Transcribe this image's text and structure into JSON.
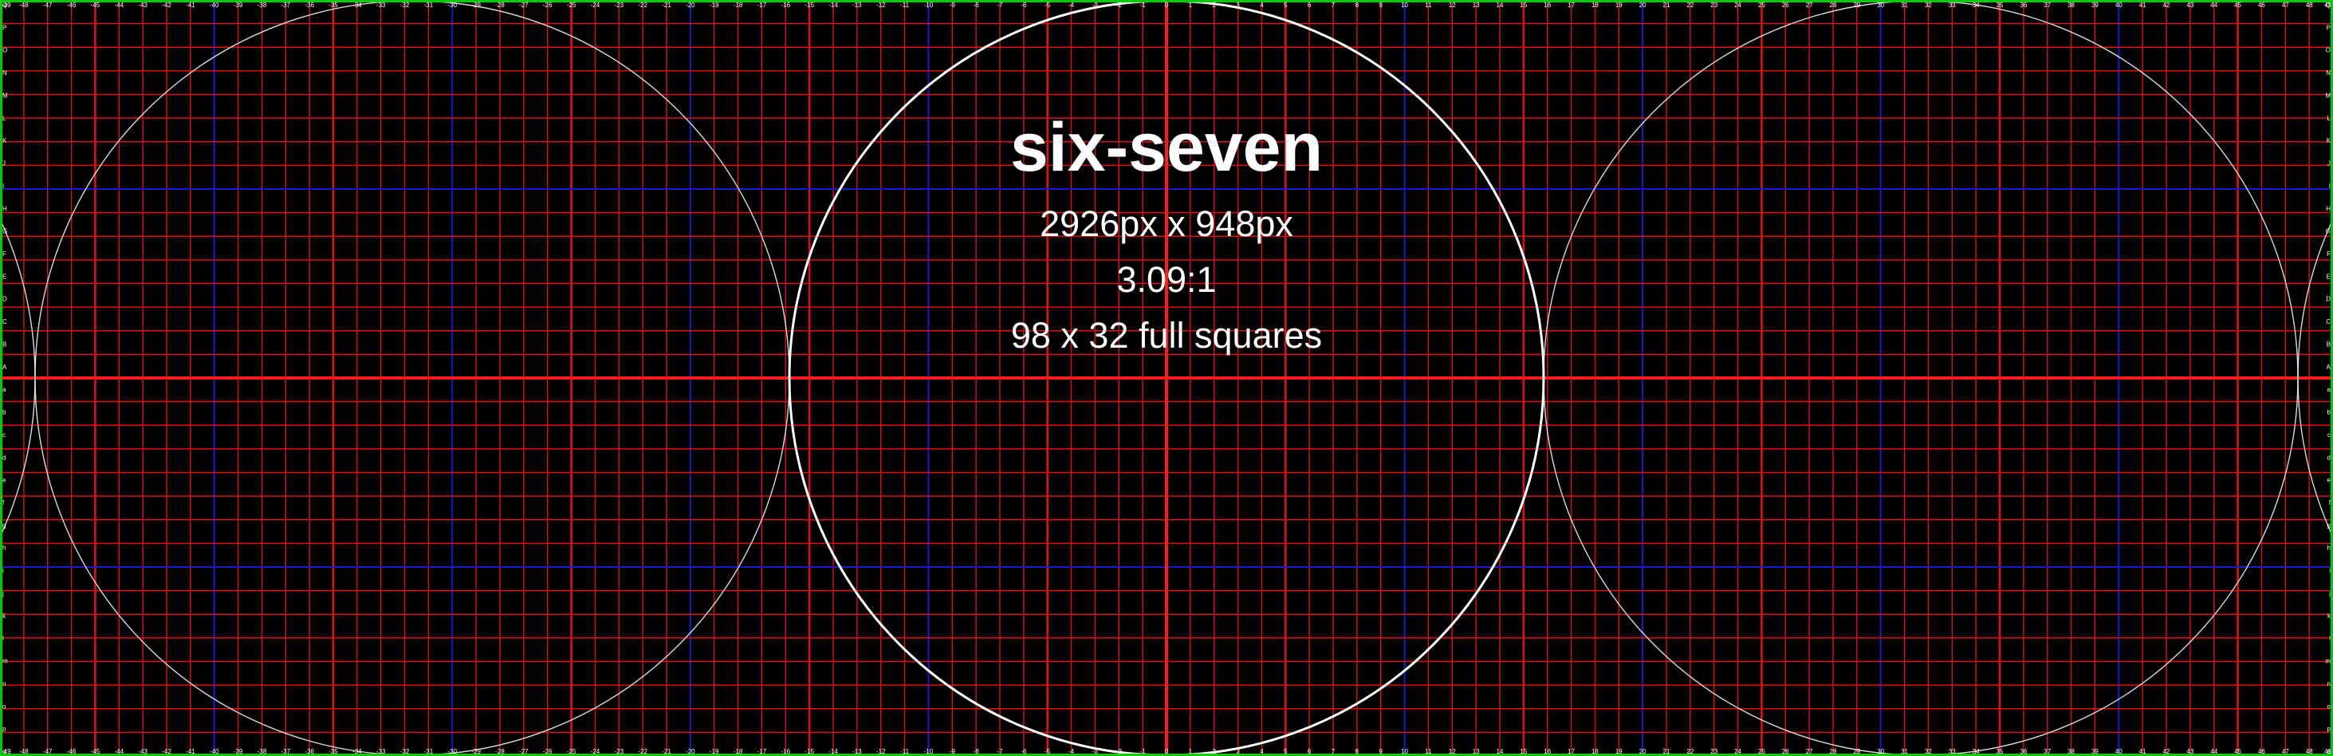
{
  "title": "six-seven",
  "dimensions_text": "2926px x 948px",
  "ratio_text": "3.09:1",
  "squares_text": "98 x 32 full squares",
  "grid": {
    "columns": 98,
    "rows": 32,
    "column_tick_start": -49,
    "column_tick_end": 49,
    "row_ticks": [
      "Q",
      "P",
      "O",
      "N",
      "M",
      "L",
      "K",
      "J",
      "I",
      "H",
      "G",
      "F",
      "E",
      "D",
      "C",
      "B",
      "A",
      "a",
      "b",
      "c",
      "d",
      "e",
      "f",
      "g",
      "h",
      "i",
      "j",
      "k",
      "l",
      "m",
      "n",
      "o",
      "p",
      "q"
    ]
  },
  "colors": {
    "background": "#000000",
    "grid_line": "#e01010",
    "major_vertical": "#1a1acc",
    "center_line": "#ff1a1a",
    "border": "#00cc00",
    "circle": "#ffffff",
    "text": "#ffffff",
    "tick_text": "#ffffff"
  }
}
